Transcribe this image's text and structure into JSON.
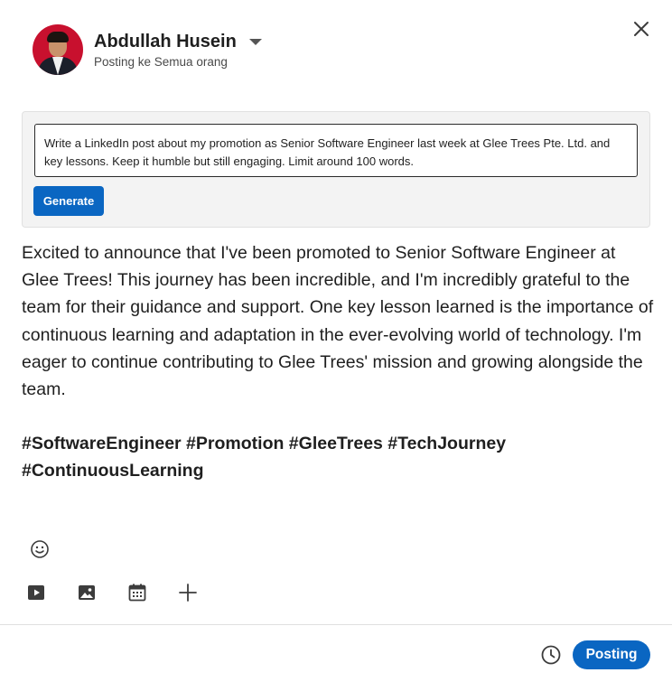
{
  "composer": {
    "user_name": "Abdullah Husein",
    "audience": "Posting ke Semua orang"
  },
  "ai_prompt": {
    "input_value": "Write a LinkedIn post about my promotion as Senior Software Engineer last week at Glee Trees Pte. Ltd. and key lessons. Keep it humble but still engaging. Limit around 100 words.",
    "generate_label": "Generate"
  },
  "post": {
    "body": "Excited to announce that I've been promoted to Senior Software Engineer at Glee Trees! This journey has been incredible, and I'm incredibly grateful to the team for their guidance and support.  One key lesson learned is the importance of continuous learning and adaptation in the ever-evolving world of technology. I'm eager to continue contributing to Glee Trees' mission and growing alongside the team.",
    "hashtags": "#SoftwareEngineer #Promotion #GleeTrees #TechJourney #ContinuousLearning"
  },
  "footer": {
    "post_label": "Posting"
  },
  "icons": {
    "close": "close-icon",
    "dropdown": "caret-down-icon",
    "emoji": "emoji-icon",
    "video": "video-icon",
    "photo": "photo-icon",
    "event": "calendar-icon",
    "more": "plus-icon",
    "schedule": "clock-icon"
  },
  "colors": {
    "accent": "#0a66c2",
    "prompt_panel": "#f3f3f3"
  }
}
